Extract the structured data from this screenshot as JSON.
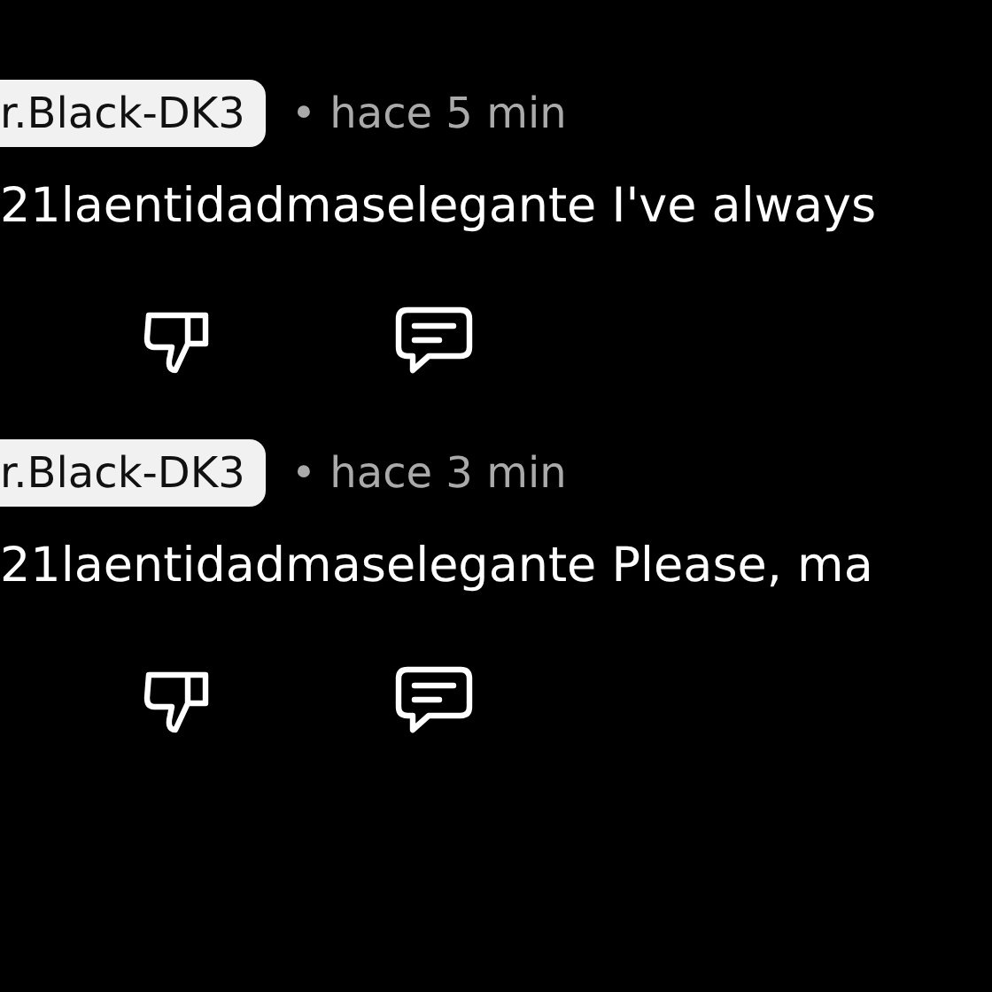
{
  "comments": [
    {
      "author": "r.Black-DK3",
      "time": "• hace 5 min",
      "text": "21laentidadmaselegante I've always"
    },
    {
      "author": "r.Black-DK3",
      "time": "• hace 3 min",
      "text": "21laentidadmaselegante Please, ma"
    }
  ]
}
